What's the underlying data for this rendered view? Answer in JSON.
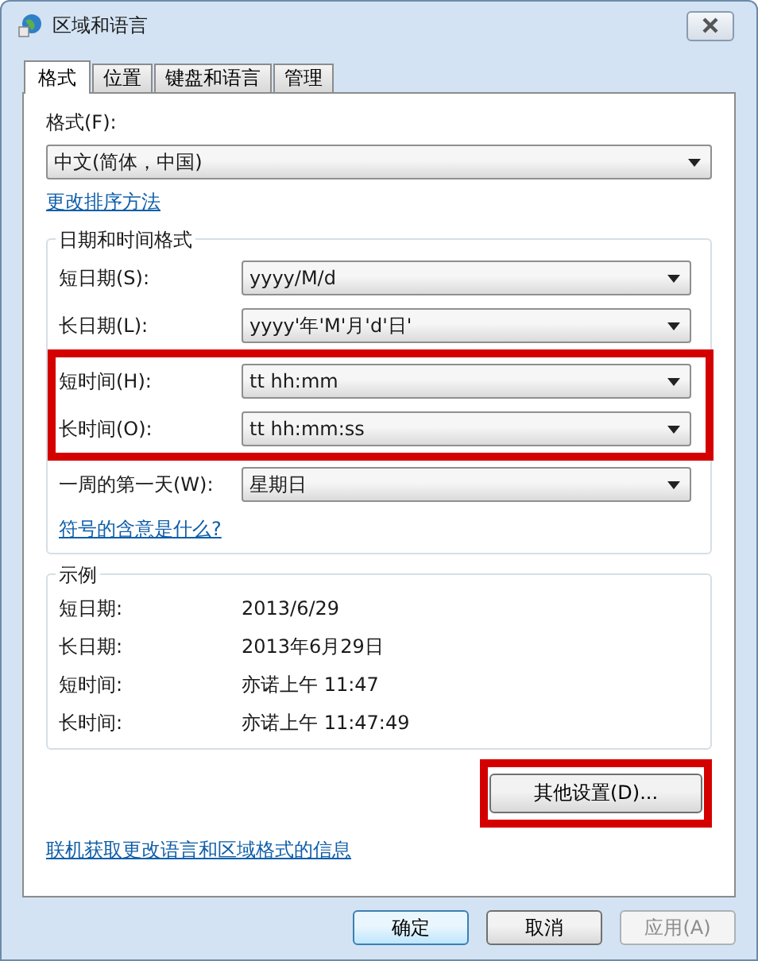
{
  "window": {
    "title": "区域和语言"
  },
  "tabs": [
    {
      "label": "格式",
      "selected": true
    },
    {
      "label": "位置",
      "selected": false
    },
    {
      "label": "键盘和语言",
      "selected": false
    },
    {
      "label": "管理",
      "selected": false
    }
  ],
  "format": {
    "label": "格式(F):",
    "value": "中文(简体，中国)"
  },
  "sort_link": "更改排序方法",
  "date_time_group": {
    "title": "日期和时间格式",
    "rows": [
      {
        "label": "短日期(S):",
        "value": "yyyy/M/d",
        "highlighted": false
      },
      {
        "label": "长日期(L):",
        "value": "yyyy'年'M'月'd'日'",
        "highlighted": false
      },
      {
        "label": "短时间(H):",
        "value": "tt hh:mm",
        "highlighted": true
      },
      {
        "label": "长时间(O):",
        "value": "tt hh:mm:ss",
        "highlighted": true
      },
      {
        "label": "一周的第一天(W):",
        "value": "星期日",
        "highlighted": false
      }
    ],
    "link": "符号的含意是什么?"
  },
  "examples_group": {
    "title": "示例",
    "rows": [
      {
        "label": "短日期:",
        "value": "2013/6/29"
      },
      {
        "label": "长日期:",
        "value": "2013年6月29日"
      },
      {
        "label": "短时间:",
        "value": "亦诺上午 11:47"
      },
      {
        "label": "长时间:",
        "value": "亦诺上午 11:47:49"
      }
    ]
  },
  "other_settings_button": {
    "label": "其他设置(D)...",
    "highlighted": true
  },
  "online_link": "联机获取更改语言和区域格式的信息",
  "buttons": [
    {
      "label": "确定",
      "kind": "default",
      "disabled": false
    },
    {
      "label": "取消",
      "kind": "normal",
      "disabled": false
    },
    {
      "label": "应用(A)",
      "kind": "normal",
      "disabled": true
    }
  ]
}
